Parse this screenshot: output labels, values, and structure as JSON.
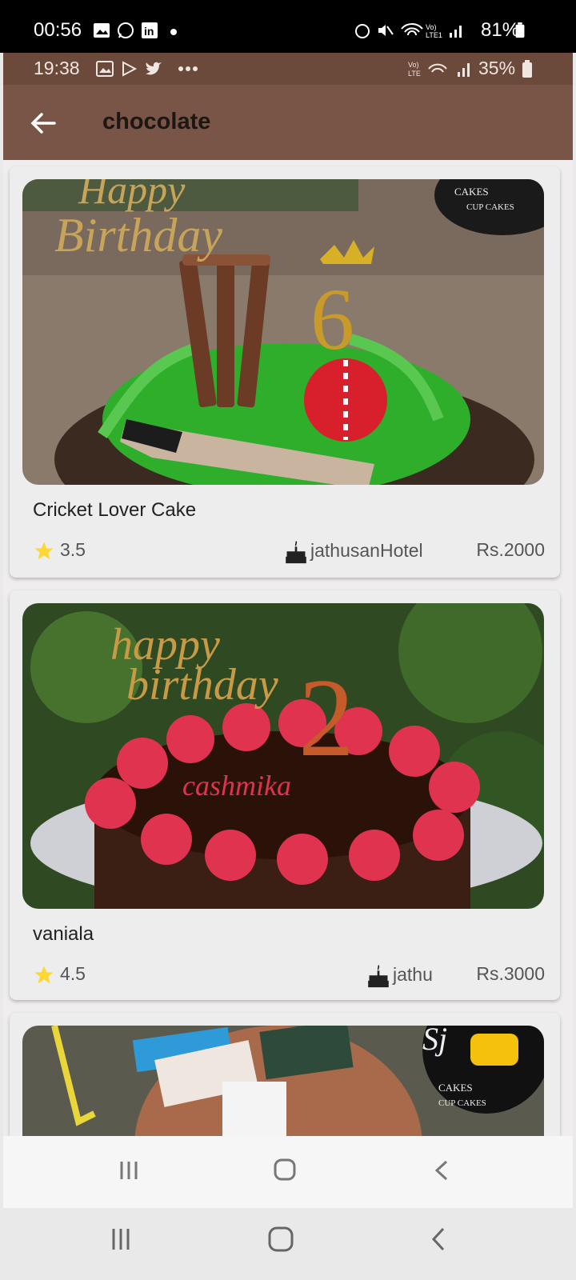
{
  "phone_status": {
    "time": "00:56",
    "battery": "81%"
  },
  "inner_status": {
    "time": "19:38",
    "battery": "35%"
  },
  "appbar": {
    "title": "chocolate"
  },
  "products": [
    {
      "name": "Cricket Lover Cake",
      "rating": "3.5",
      "shop": "jathusanHotel",
      "price": "Rs.2000",
      "image": "cricket-cake-photo"
    },
    {
      "name": "vaniala",
      "rating": "4.5",
      "shop": "jathu",
      "price": "Rs.3000",
      "image": "birthday-cake-photo"
    },
    {
      "name": "",
      "rating": "",
      "shop": "",
      "price": "",
      "image": "cake-photo-partial"
    }
  ],
  "colors": {
    "appbar": "#795548",
    "status": "#6b4a3c",
    "star": "#fdd835"
  }
}
